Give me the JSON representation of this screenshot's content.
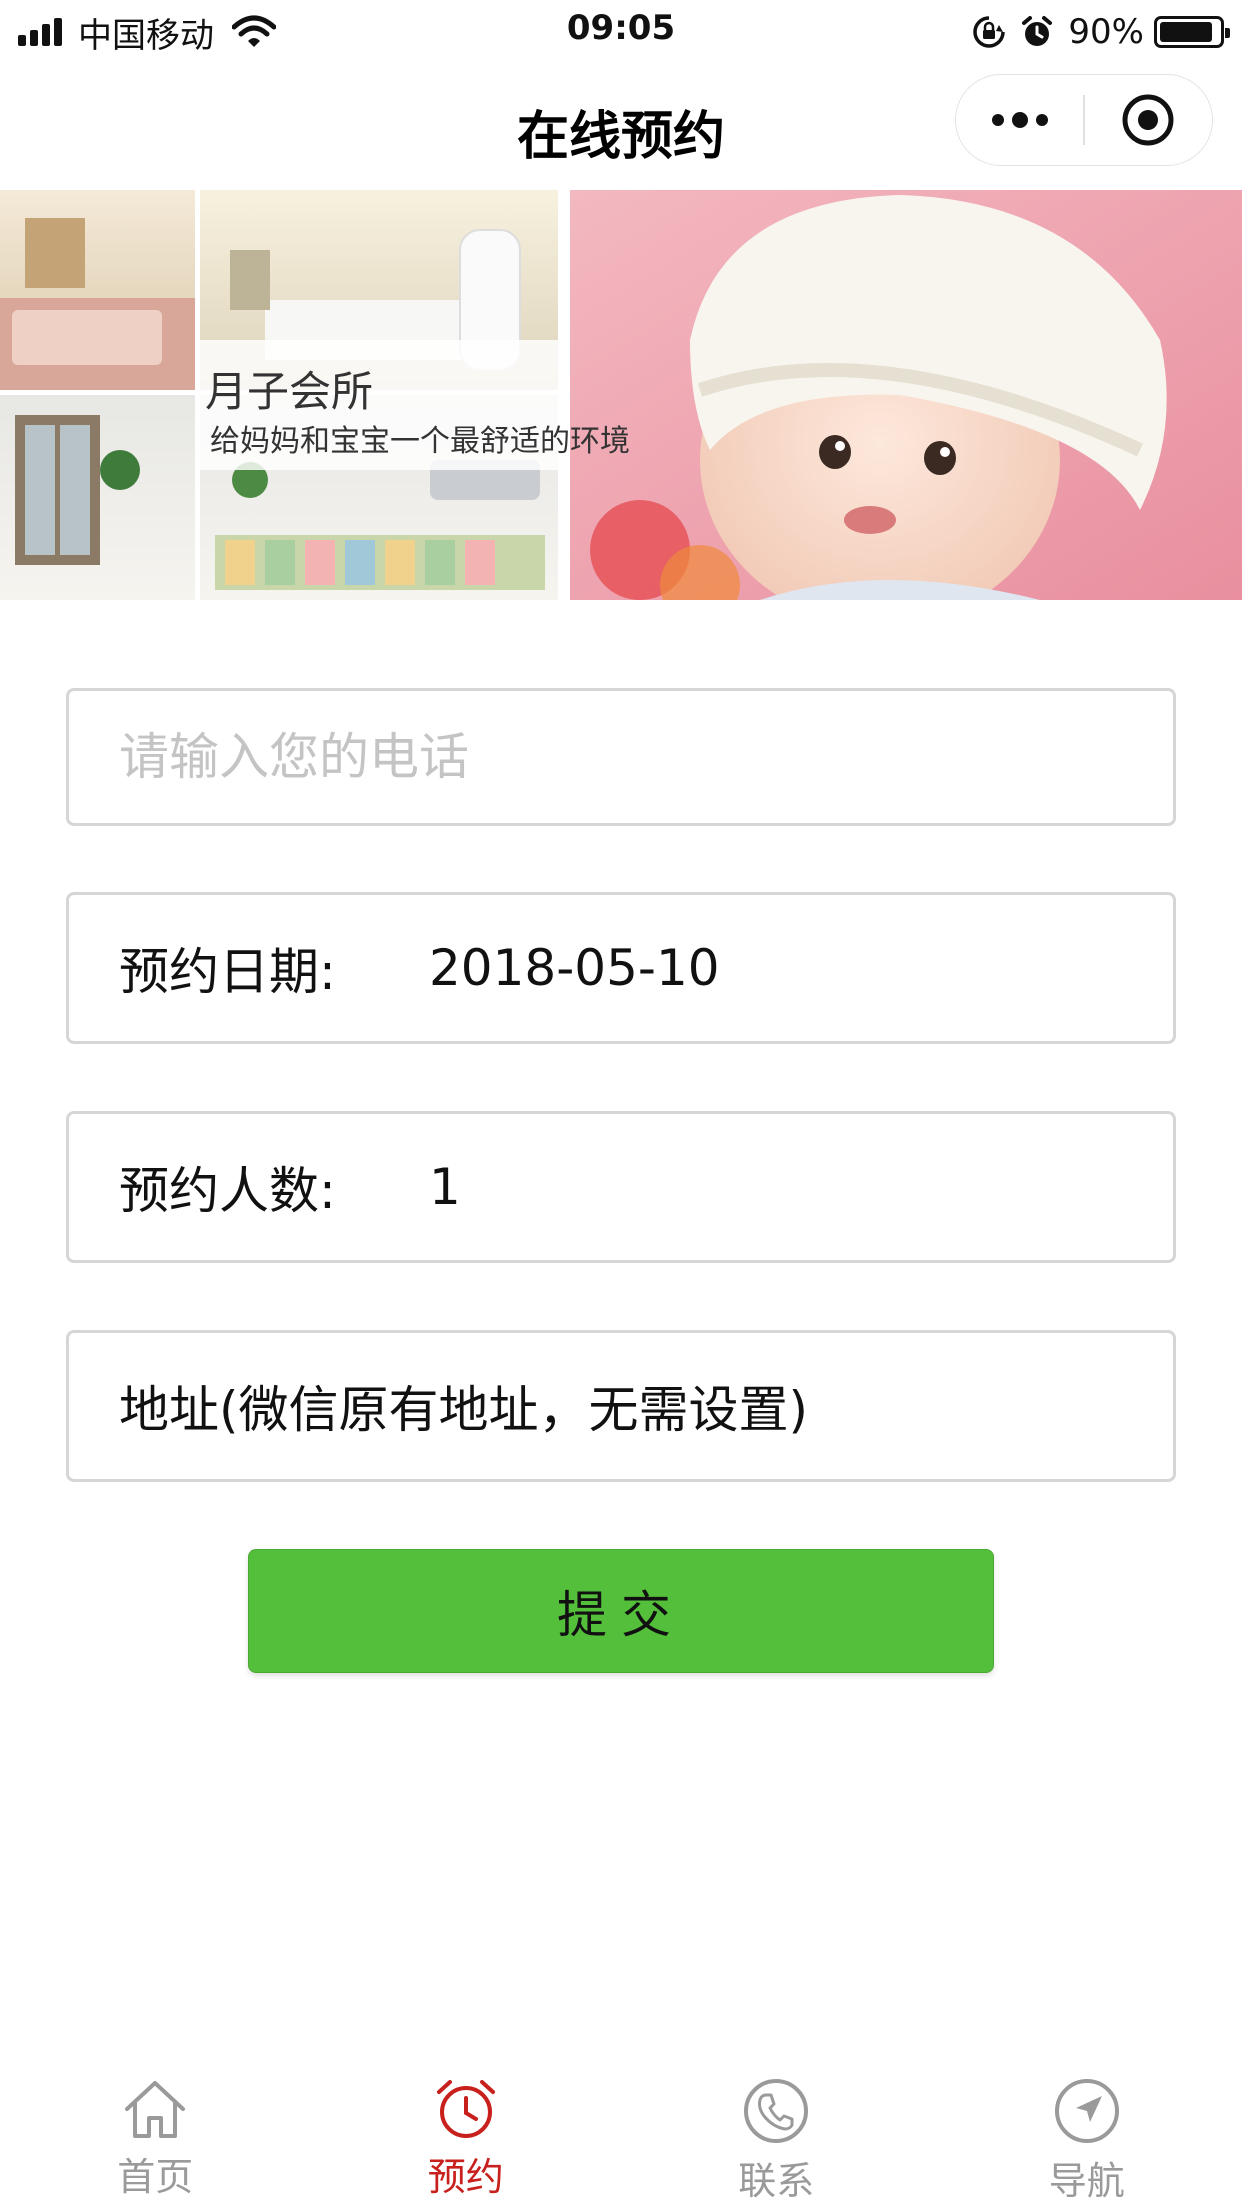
{
  "status_bar": {
    "carrier": "中国移动",
    "time": "09:05",
    "battery_percent": "90%",
    "battery_level": 0.9,
    "icons": [
      "signal-icon",
      "wifi-icon",
      "orientation-lock-icon",
      "alarm-icon",
      "battery-icon"
    ]
  },
  "nav": {
    "title": "在线预约",
    "more_icon": "more-dots-icon",
    "close_icon": "record-target-icon"
  },
  "banner": {
    "title": "月子会所",
    "subtitle": "给妈妈和宝宝一个最舒适的环境"
  },
  "form": {
    "phone_placeholder": "请输入您的电话",
    "phone_value": "",
    "date_label": "预约日期:",
    "date_value": "2018-05-10",
    "count_label": "预约人数:",
    "count_value": "1",
    "address_text": "地址(微信原有地址，无需设置)",
    "submit_label": "提交"
  },
  "colors": {
    "submit_bg": "#54bf3a",
    "tab_active": "#c8201c",
    "tab_inactive": "#9a9a9a"
  },
  "tabs": [
    {
      "label": "首页",
      "icon": "home-icon",
      "active": false
    },
    {
      "label": "预约",
      "icon": "alarm-clock-icon",
      "active": true
    },
    {
      "label": "联系",
      "icon": "phone-icon",
      "active": false
    },
    {
      "label": "导航",
      "icon": "navigation-icon",
      "active": false
    }
  ]
}
